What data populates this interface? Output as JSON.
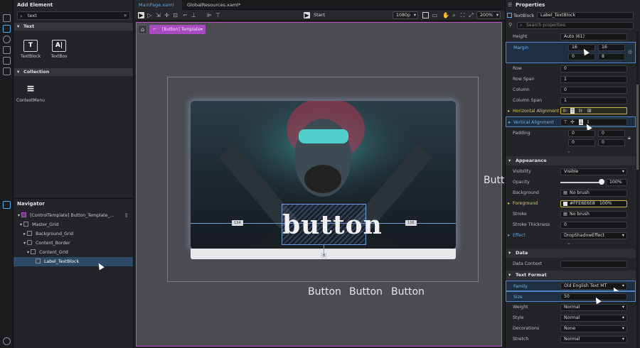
{
  "add_element": {
    "title": "Add Element",
    "search_value": "text",
    "section_text": "Text",
    "tiles_text": [
      {
        "label": "TextBlock",
        "glyph": "T"
      },
      {
        "label": "TextBox",
        "glyph": "A|"
      }
    ],
    "section_collection": "Collection",
    "tiles_collection": [
      {
        "label": "ContextMenu",
        "glyph": "≡"
      }
    ]
  },
  "navigator": {
    "title": "Navigator",
    "items": [
      {
        "label": "[ControlTemplate] Button_Template_..."
      },
      {
        "label": "Master_Grid"
      },
      {
        "label": "Background_Grid"
      },
      {
        "label": "Content_Border"
      },
      {
        "label": "Content_Grid"
      },
      {
        "label": "Label_TextBlock"
      }
    ]
  },
  "tabs": [
    {
      "label": "MainPage.xaml"
    },
    {
      "label": "GlobalResources.xaml*"
    }
  ],
  "toolbar": {
    "start_label": "Start",
    "resolution": "1080p",
    "zoom": "200%"
  },
  "canvas": {
    "template_chip": "[Button] Template",
    "button_label": "button",
    "guide_left": "134",
    "guide_right": "136",
    "guide_bottom": "8",
    "side_label": "Butt",
    "bottom_buttons": [
      "Button",
      "Button",
      "Button"
    ]
  },
  "properties": {
    "title": "Properties",
    "element_type": "TextBlock",
    "element_name": "Label_TextBlock",
    "search_placeholder": "Search properties",
    "height_label": "Height",
    "height_value": "Auto (61)",
    "margin_label": "Margin",
    "margin_values": [
      "16",
      "16",
      "0",
      "8"
    ],
    "row_label": "Row",
    "row_value": "0",
    "rowspan_label": "Row Span",
    "rowspan_value": "1",
    "column_label": "Column",
    "column_value": "0",
    "colspan_label": "Column Span",
    "colspan_value": "1",
    "halign_label": "Horizontal Alignment",
    "valign_label": "Vertical Alignment",
    "padding_label": "Padding",
    "padding_values": [
      "0",
      "0",
      "0",
      "0"
    ],
    "appearance_section": "Appearance",
    "visibility_label": "Visibility",
    "visibility_value": "Visible",
    "opacity_label": "Opacity",
    "opacity_value": "100%",
    "opacity_fraction": 1.0,
    "background_label": "Background",
    "background_value": "No brush",
    "foreground_label": "Foreground",
    "foreground_value": "#FFE6E6E8",
    "foreground_pct": "100%",
    "stroke_label": "Stroke",
    "stroke_value": "No brush",
    "strokethick_label": "Stroke Thickness",
    "strokethick_value": "0",
    "effect_label": "Effect",
    "effect_value": "DropShadowEffect",
    "data_section": "Data",
    "datacontext_label": "Data Context",
    "textformat_section": "Text Format",
    "family_label": "Family",
    "family_value": "Old English Text MT",
    "size_label": "Size",
    "size_value": "50",
    "weight_label": "Weight",
    "weight_value": "Normal",
    "style_label": "Style",
    "style_value": "Normal",
    "decorations_label": "Decorations",
    "decorations_value": "None",
    "stretch_label": "Stretch",
    "stretch_value": "Normal"
  },
  "colors": {
    "accent": "#5aa8ee",
    "template": "#a84bc0",
    "highlight_yellow": "#c8b84b"
  }
}
